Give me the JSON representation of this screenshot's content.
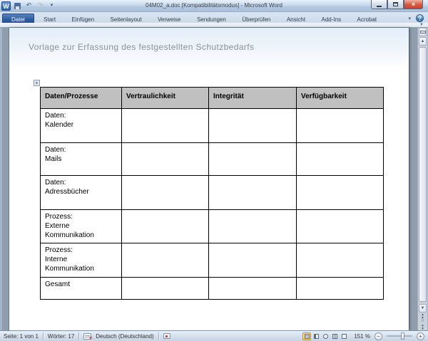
{
  "window": {
    "title": "04M02_a.doc [Kompatibilitätsmodus] - Microsoft Word"
  },
  "ribbon": {
    "tabs": [
      "Datei",
      "Start",
      "Einfügen",
      "Seitenlayout",
      "Verweise",
      "Sendungen",
      "Überprüfen",
      "Ansicht",
      "Add-Ins",
      "Acrobat"
    ]
  },
  "doc": {
    "heading": "Vorlage zur Erfassung des festgestellten Schutzbedarfs",
    "table": {
      "headers": [
        "Daten/Prozesse",
        "Vertraulichkeit",
        "Integrität",
        "Verfügbarkeit"
      ],
      "rows": [
        {
          "label": "Daten:\nKalender",
          "cells": [
            "",
            "",
            ""
          ]
        },
        {
          "label": "Daten:\nMails",
          "cells": [
            "",
            "",
            ""
          ]
        },
        {
          "label": "Daten:\nAdressbücher",
          "cells": [
            "",
            "",
            ""
          ]
        },
        {
          "label": "Prozess:\nExterne\nKommunikation",
          "cells": [
            "",
            "",
            ""
          ]
        },
        {
          "label": "Prozess:\nInterne\nKommunikation",
          "cells": [
            "",
            "",
            ""
          ]
        },
        {
          "label": "Gesamt",
          "cells": [
            "",
            "",
            ""
          ]
        }
      ]
    }
  },
  "status": {
    "page_indicator": "Seite: 1 von 1",
    "word_count": "Wörter: 17",
    "language": "Deutsch (Deutschland)",
    "zoom_level": "151 %"
  },
  "icons": {
    "word_logo": "W",
    "undo": "↶",
    "redo": "↷",
    "qat_dropdown": "▾",
    "ribbon_dropdown": "▾",
    "help": "?",
    "ribbon_expand": "▼",
    "close": "×",
    "table_handle": "+",
    "scroll_up": "▲",
    "scroll_down": "▼",
    "page_chevron_up": "▲",
    "page_chevron_down": "▼",
    "browse_circle": "○",
    "zoom_out": "−",
    "zoom_in": "+"
  },
  "colors": {
    "file_tab_blue": "#2d5b9e",
    "table_header_gray": "#c0c0c0",
    "active_view_highlight": "#f9c95c",
    "close_button_red": "#d8573d",
    "canvas_gray": "#8f9dad"
  }
}
